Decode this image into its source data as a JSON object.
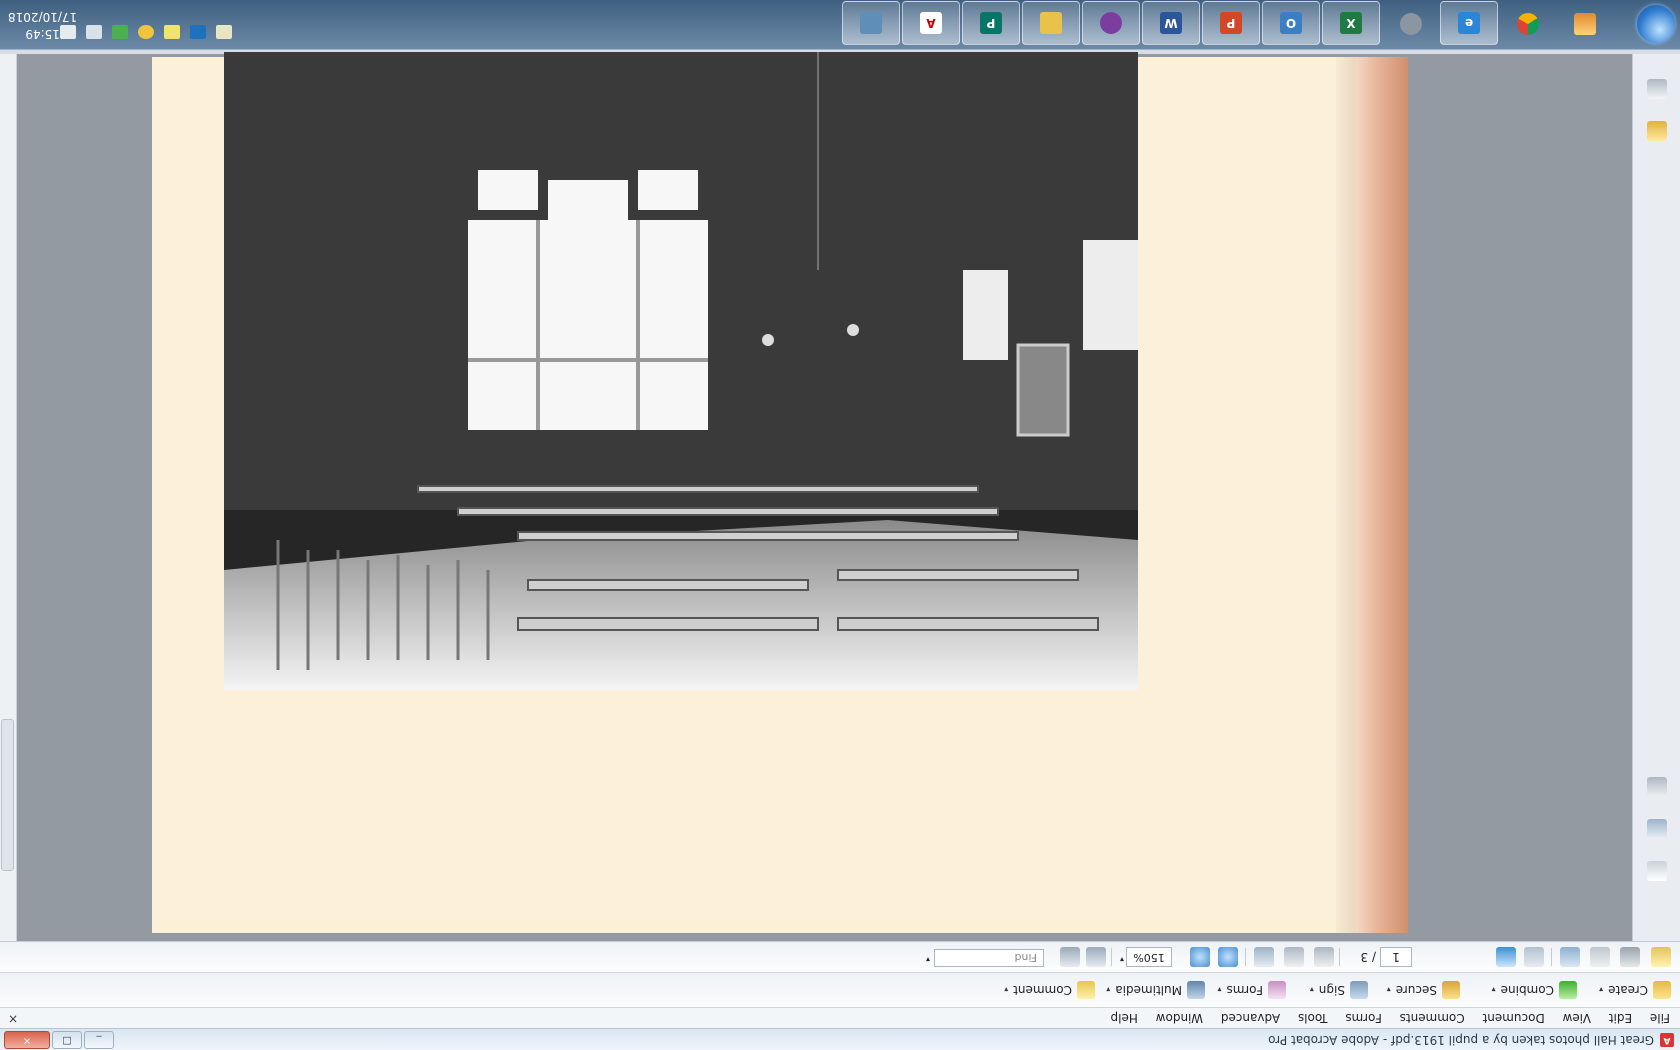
{
  "window": {
    "title": "Great Hall photos taken by a pupil 1913.pdf - Adobe Acrobat Pro",
    "app_icon": "acrobat-icon",
    "buttons": [
      "_",
      "□",
      "×"
    ]
  },
  "menu": {
    "items": [
      "File",
      "Edit",
      "View",
      "Document",
      "Comments",
      "Forms",
      "Tools",
      "Advanced",
      "Window",
      "Help"
    ],
    "close_doc": "×"
  },
  "tasks": {
    "create": "Create",
    "combine": "Combine",
    "secure": "Secure",
    "sign": "Sign",
    "forms": "Forms",
    "multimedia": "Multimedia",
    "comment": "Comment",
    "caret": "▾"
  },
  "toolbar": {
    "page_current": "1",
    "page_total": "/ 3",
    "zoom": "150%",
    "zoom_caret": "▾",
    "find_placeholder": "Find",
    "find_caret": "▾"
  },
  "document": {
    "photo_subject": "interior of a great hall with tall gothic windows, benches and chairs"
  },
  "taskbar": {
    "apps": [
      "screen-app",
      "acrobat",
      "publisher",
      "explorer",
      "onenote-purple",
      "word",
      "powerpoint",
      "photos",
      "excel",
      "settings",
      "internet-explorer",
      "chrome",
      "start-menu-apps"
    ],
    "clock_time": "15:49",
    "clock_date": "17/10/2018"
  },
  "colors": {
    "accent": "#3f5f80",
    "page": "#fdf0d8",
    "close": "#d9634c"
  }
}
